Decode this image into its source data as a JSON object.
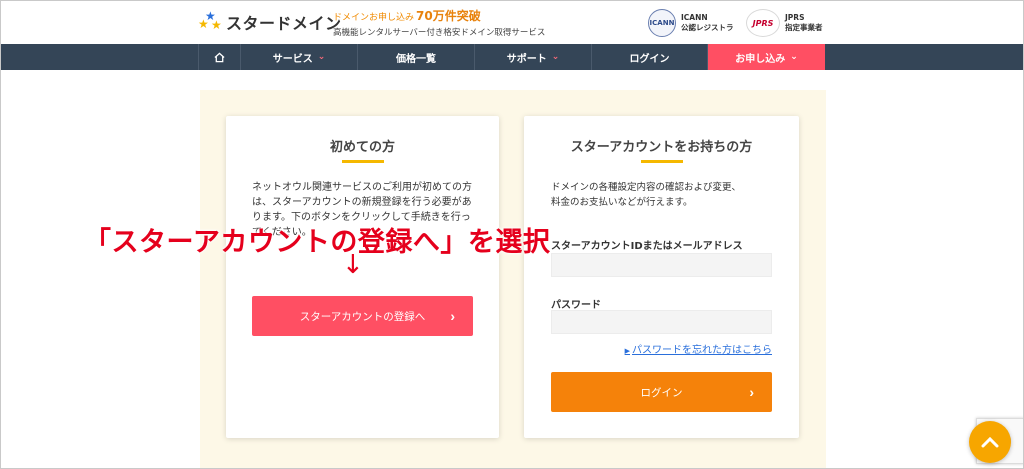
{
  "header": {
    "logo_text": "スタードメイン",
    "tagline_pre": "ドメインお申し込み",
    "tagline_big": "70万件突破",
    "tagline_sub": "高機能レンタルサーバー付き格安ドメイン取得サービス",
    "icann_badge_text": "ICANN",
    "icann_line1": "ICANN",
    "icann_line2": "公認レジストラ",
    "jprs_badge_text": "JPRS",
    "jprs_line1": "JPRS",
    "jprs_line2": "指定事業者"
  },
  "nav": {
    "home_icon": "home-icon",
    "service": "サービス",
    "price": "価格一覧",
    "support": "サポート",
    "login": "ログイン",
    "apply": "お申し込み",
    "chevron": "⌄"
  },
  "left_card": {
    "title": "初めての方",
    "text": "ネットオウル関連サービスのご利用が初めての方は、スターアカウントの新規登録を行う必要があります。下のボタンをクリックして手続きを行ってください。",
    "button_label": "スターアカウントの登録へ"
  },
  "right_card": {
    "title": "スターアカウントをお持ちの方",
    "text_line1": "ドメインの各種設定内容の確認および変更、",
    "text_line2": "料金のお支払いなどが行えます。",
    "id_label": "スターアカウントIDまたはメールアドレス",
    "id_value": "",
    "password_label": "パスワード",
    "password_value": "",
    "forgot_link": "パスワードを忘れた方はこちら",
    "login_button": "ログイン"
  },
  "annotation": {
    "text": "「スターアカウントの登録へ」を選択",
    "arrow": "↓"
  },
  "colors": {
    "nav_bg": "#344557",
    "accent_red": "#ff4f63",
    "accent_orange": "#f5820a",
    "band_bg": "#fdf8e7",
    "underline_yellow": "#f5b800",
    "annotation_red": "#e5001c"
  }
}
